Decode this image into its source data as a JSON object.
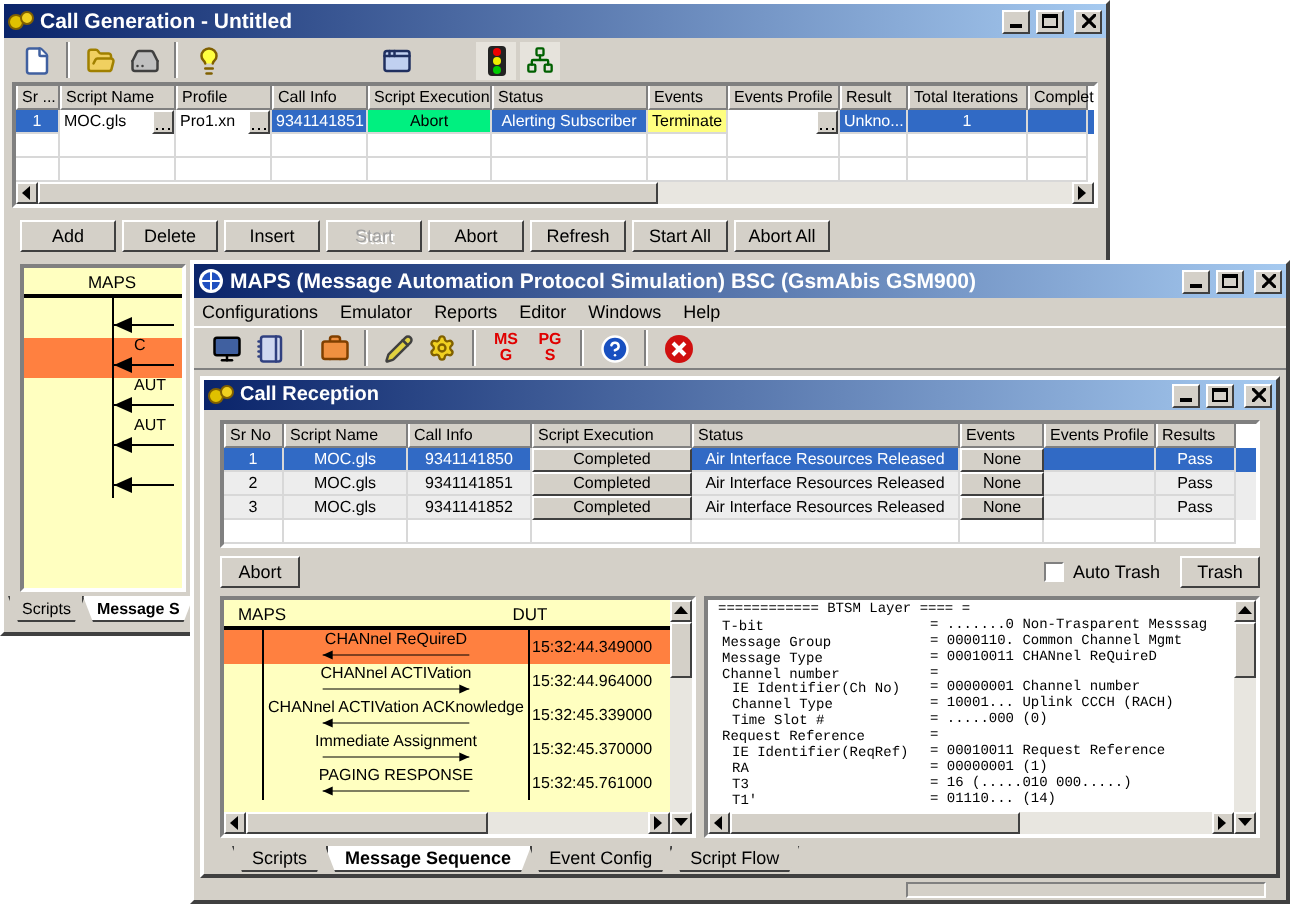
{
  "call_generation": {
    "title": "Call Generation - Untitled",
    "table": {
      "columns": [
        "Sr ...",
        "Script Name",
        "Profile",
        "Call Info",
        "Script Execution",
        "Status",
        "Events",
        "Events Profile",
        "Result",
        "Total Iterations",
        "Complet"
      ],
      "rows": [
        {
          "sr": "1",
          "script": "MOC.gls",
          "profile": "Pro1.xn",
          "call_info": "9341141851",
          "execution": "Abort",
          "status": "Alerting Subscriber",
          "events": "Terminate",
          "result": "Unkno...",
          "iterations": "1",
          "selected": true
        }
      ]
    },
    "buttons": [
      {
        "label": "Add",
        "disabled": false
      },
      {
        "label": "Delete",
        "disabled": false
      },
      {
        "label": "Insert",
        "disabled": false
      },
      {
        "label": "Start",
        "disabled": true
      },
      {
        "label": "Abort",
        "disabled": false
      },
      {
        "label": "Refresh",
        "disabled": false
      },
      {
        "label": "Start All",
        "disabled": false
      },
      {
        "label": "Abort All",
        "disabled": false
      }
    ],
    "sequence": {
      "lifeline": "MAPS",
      "messages": [
        {
          "kind": "left",
          "selected": false
        },
        {
          "label": "C",
          "kind": "left",
          "selected": true
        },
        {
          "label": "AUT",
          "kind": "left",
          "selected": false
        },
        {
          "label": "AUT",
          "kind": "left",
          "selected": false
        },
        {
          "kind": "left",
          "selected": false
        }
      ]
    },
    "tabs": [
      {
        "label": "Scripts",
        "selected": false
      },
      {
        "label": "Message S",
        "selected": true
      }
    ]
  },
  "maps": {
    "title": "MAPS (Message Automation Protocol Simulation) BSC (GsmAbis GSM900)",
    "menu": [
      "Configurations",
      "Emulator",
      "Reports",
      "Editor",
      "Windows",
      "Help"
    ],
    "toolbar_badges": [
      [
        "MS",
        "G"
      ],
      [
        "PG",
        "S"
      ]
    ],
    "call_reception": {
      "title": "Call Reception",
      "table": {
        "columns": [
          "Sr No",
          "Script Name",
          "Call Info",
          "Script Execution",
          "Status",
          "Events",
          "Events Profile",
          "Results"
        ],
        "rows": [
          {
            "sr": "1",
            "script": "MOC.gls",
            "call_info": "9341141850",
            "execution": "Completed",
            "status": "Air Interface Resources Released",
            "events": "None",
            "result": "Pass",
            "selected": true
          },
          {
            "sr": "2",
            "script": "MOC.gls",
            "call_info": "9341141851",
            "execution": "Completed",
            "status": "Air Interface Resources Released",
            "events": "None",
            "result": "Pass",
            "selected": false
          },
          {
            "sr": "3",
            "script": "MOC.gls",
            "call_info": "9341141852",
            "execution": "Completed",
            "status": "Air Interface Resources Released",
            "events": "None",
            "result": "Pass",
            "selected": false
          }
        ]
      },
      "abort_button": "Abort",
      "auto_trash": {
        "label": "Auto Trash",
        "checked": false
      },
      "trash_button": "Trash",
      "sequence": {
        "columns": [
          "MAPS",
          "DUT"
        ],
        "messages": [
          {
            "label": "CHANnel ReQuireD",
            "time": "15:32:44.349000",
            "kind": "left",
            "selected": true
          },
          {
            "label": "CHANnel ACTIVation",
            "time": "15:32:44.964000",
            "kind": "right",
            "selected": false
          },
          {
            "label": "CHANnel ACTIVation ACKnowledge",
            "time": "15:32:45.339000",
            "kind": "left",
            "selected": false
          },
          {
            "label": "Immediate Assignment",
            "time": "15:32:45.370000",
            "kind": "right",
            "selected": false
          },
          {
            "label": "PAGING RESPONSE",
            "time": "15:32:45.761000",
            "kind": "left",
            "selected": false
          }
        ]
      },
      "decode": {
        "header": "============ BTSM Layer ==== =",
        "fields": [
          {
            "name": "T-bit",
            "value": "= .......0 Non-Trasparent Messsag"
          },
          {
            "name": "Message Group",
            "value": "= 0000110. Common Channel Mgmt"
          },
          {
            "name": "Message Type",
            "value": "= 00010011 CHANnel ReQuireD"
          },
          {
            "name": "Channel number",
            "value": "=",
            "children": [
              {
                "name": "IE Identifier(Ch No)",
                "value": "= 00000001 Channel number"
              },
              {
                "name": "Channel Type",
                "value": "= 10001... Uplink CCCH (RACH)"
              },
              {
                "name": "Time Slot #",
                "value": "= .....000 (0)"
              }
            ]
          },
          {
            "name": "Request Reference",
            "value": "=",
            "children": [
              {
                "name": "IE Identifier(ReqRef)",
                "value": "= 00010011 Request Reference"
              },
              {
                "name": "RA",
                "value": "= 00000001 (1)"
              },
              {
                "name": "T3",
                "value": "= 16 (.....010 000.....)"
              },
              {
                "name": "T1'",
                "value": "= 01110... (14)"
              }
            ]
          }
        ]
      },
      "tabs": [
        {
          "label": "Scripts",
          "selected": false
        },
        {
          "label": "Message Sequence",
          "selected": true
        },
        {
          "label": "Event Config",
          "selected": false
        },
        {
          "label": "Script Flow",
          "selected": false
        }
      ]
    }
  }
}
